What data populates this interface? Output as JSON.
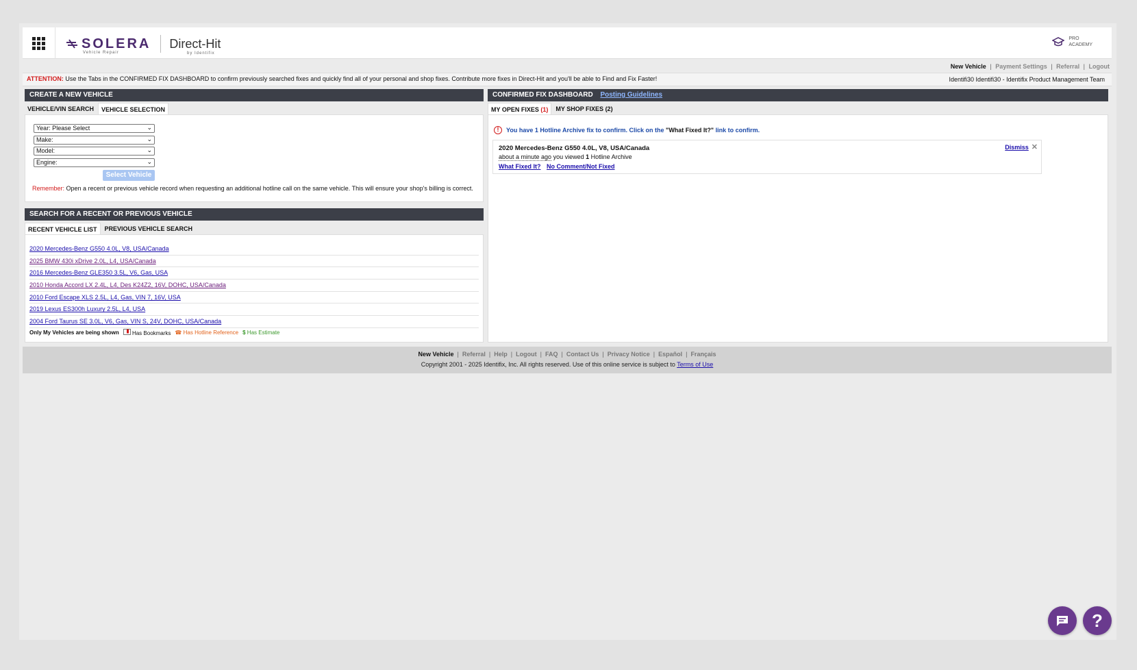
{
  "header": {
    "brand": "SOLERA",
    "brand_sub": "Vehicle Repair",
    "product": "Direct-Hit",
    "product_sub": "by Identifix",
    "pro_academy_line1": "PRO",
    "pro_academy_line2": "ACADEMY"
  },
  "topnav": {
    "new_vehicle": "New Vehicle",
    "payment_settings": "Payment Settings",
    "referral": "Referral",
    "logout": "Logout",
    "sep": "|"
  },
  "attention": {
    "label": "ATTENTION:",
    "message": "Use the Tabs in the CONFIRMED FIX DASHBOARD to confirm previously searched fixes and quickly find all of your personal and shop fixes. Contribute more fixes in Direct-Hit and you'll be able to Find and Fix Faster!",
    "user": "Identifi30 Identifi30 - Identifix Product Management Team"
  },
  "create_vehicle": {
    "title": "CREATE A NEW VEHICLE",
    "tabs": [
      "VEHICLE/VIN SEARCH",
      "VEHICLE SELECTION"
    ],
    "year": "Year: Please Select",
    "make": "Make:",
    "model": "Model:",
    "engine": "Engine:",
    "select_button": "Select Vehicle",
    "remember_label": "Remember:",
    "remember_text": "Open a recent or previous vehicle record when requesting an additional hotline call on the same vehicle. This will ensure your shop's billing is correct."
  },
  "search_vehicle": {
    "title": "SEARCH FOR A RECENT OR PREVIOUS VEHICLE",
    "tabs": [
      "RECENT VEHICLE LIST",
      "PREVIOUS VEHICLE SEARCH"
    ],
    "vehicles": [
      "2020 Mercedes-Benz G550 4.0L, V8, USA/Canada",
      "2025 BMW 430i xDrive 2.0L, L4, USA/Canada",
      "2016 Mercedes-Benz GLE350 3.5L, V6, Gas, USA",
      "2010 Honda Accord LX 2.4L, L4, Des K24Z2, 16V, DOHC, USA/Canada",
      "2010 Ford Escape XLS 2.5L, L4, Gas, VIN 7, 16V, USA",
      "2019 Lexus ES300h Luxury 2.5L, L4, USA",
      "2004 Ford Taurus SE 3.0L, V6, Gas, VIN S, 24V, DOHC, USA/Canada"
    ],
    "legend_only_mine": "Only My Vehicles are being shown",
    "legend_bookmarks": "Has Bookmarks",
    "legend_hotline": "Has Hotline Reference",
    "legend_estimate": "Has Estimate"
  },
  "dashboard": {
    "title": "CONFIRMED FIX DASHBOARD",
    "guidelines": "Posting Guidelines",
    "tab_open": "MY OPEN FIXES",
    "tab_open_count": "(1)",
    "tab_shop": "MY SHOP FIXES (2)",
    "alert_pre": "You have 1 Hotline Archive fix to confirm. Click on the ",
    "alert_link": "\"What Fixed It?\"",
    "alert_post": " link to confirm.",
    "fix_vehicle": "2020 Mercedes-Benz G550 4.0L, V8, USA/Canada",
    "fix_ago": "about a minute ago",
    "fix_viewed": " you viewed ",
    "fix_count": "1",
    "fix_type": " Hotline Archive",
    "what_fixed": "What Fixed It?",
    "no_comment": "No Comment/Not Fixed",
    "dismiss": "Dismiss"
  },
  "footer": {
    "links": [
      "New Vehicle",
      "Referral",
      "Help",
      "Logout",
      "FAQ",
      "Contact Us",
      "Privacy Notice",
      "Español",
      "Français"
    ],
    "copyright": "Copyright 2001 - 2025 Identifix, Inc. All rights reserved. Use of this online service is subject to ",
    "terms": "Terms of Use"
  },
  "colors": {
    "bar": "#3c3f48",
    "attention": "#d21a1a",
    "link": "#1a0dab",
    "visited": "#6a1b7a",
    "fab": "#6a3a8e"
  },
  "icons": [
    "app-grid-icon",
    "solera-logo-icon",
    "graduation-cap-icon",
    "alert-circle-icon",
    "close-icon",
    "bookmark-icon",
    "phone-icon",
    "dollar-icon",
    "chat-icon",
    "help-icon",
    "chevron-down-icon"
  ]
}
